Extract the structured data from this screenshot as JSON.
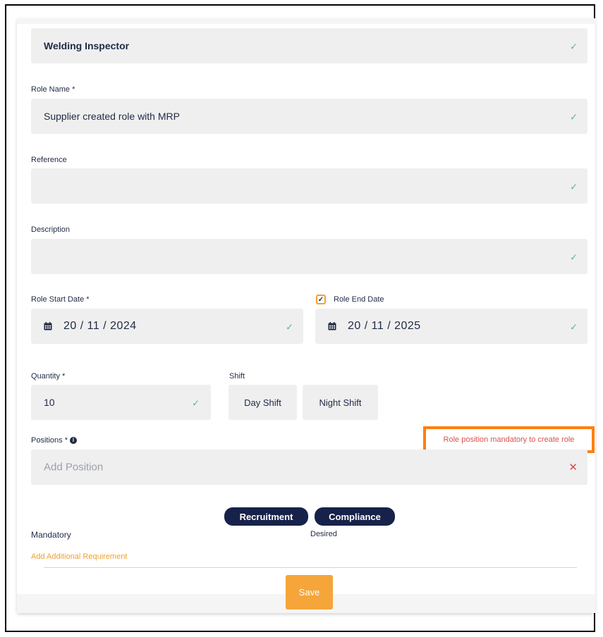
{
  "form": {
    "inspector_value": "Welding Inspector",
    "role_name_label": "Role Name *",
    "role_name_value": "Supplier created role with MRP",
    "reference_label": "Reference",
    "reference_value": "",
    "description_label": "Description",
    "description_value": "",
    "start_date_label": "Role Start Date *",
    "start_date_value": "20 / 11 / 2024",
    "end_date_label": "Role End Date",
    "end_date_checked": true,
    "end_date_value": "20 / 11 / 2025",
    "quantity_label": "Quantity *",
    "quantity_value": "10",
    "shift_label": "Shift",
    "shift_options": [
      "Day Shift",
      "Night Shift"
    ],
    "positions_label": "Positions *",
    "positions_placeholder": "Add Position",
    "positions_error": "Role position mandatory to create role",
    "tags": [
      "Recruitment",
      "Compliance"
    ],
    "mandatory_label": "Mandatory",
    "desired_label": "Desired",
    "add_requirement_link": "Add Additional Requirement",
    "save_label": "Save"
  },
  "icons": {
    "check": "check-icon",
    "cross": "cross-icon",
    "calendar": "calendar-icon",
    "info": "info-icon"
  },
  "colors": {
    "accent": "#f5a53a",
    "navy": "#17224a",
    "valid": "#5fb37a",
    "error": "#d94a4a",
    "highlight": "#ff7f0e"
  }
}
